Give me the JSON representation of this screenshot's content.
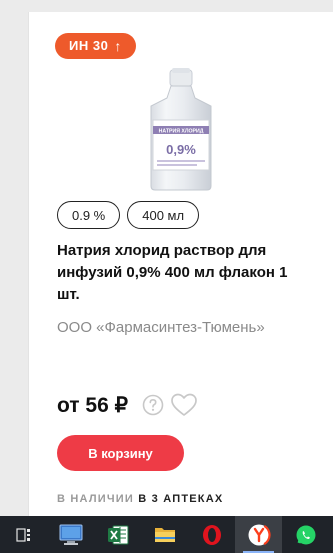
{
  "badge": {
    "label": "ИН 30",
    "arrow": "↑"
  },
  "chips": [
    "0.9 %",
    "400 мл"
  ],
  "product": {
    "title": "Натрия хлорид раствор для инфузий 0,9% 400 мл флакон 1 шт.",
    "maker": "ООО «Фармасинтез-Тюмень»"
  },
  "price": {
    "label": "от 56 ₽"
  },
  "cart_button": {
    "label": "В корзину"
  },
  "availability": {
    "prefix": "В НАЛИЧИИ",
    "count": "В 3 АПТЕКАХ"
  },
  "image_label": {
    "line1": "НАТРИЯ ХЛОРИД",
    "line2": "0,9%"
  },
  "taskbar": {
    "items": [
      "task-view-icon",
      "computer-icon",
      "excel-icon",
      "folder-icon",
      "opera-icon",
      "yandex-browser-icon",
      "whatsapp-icon"
    ],
    "active": "yandex-browser-icon"
  },
  "colors": {
    "badge": "#ee5a2b",
    "cart_button": "#ee3b46",
    "taskbar": "#1f2329"
  }
}
